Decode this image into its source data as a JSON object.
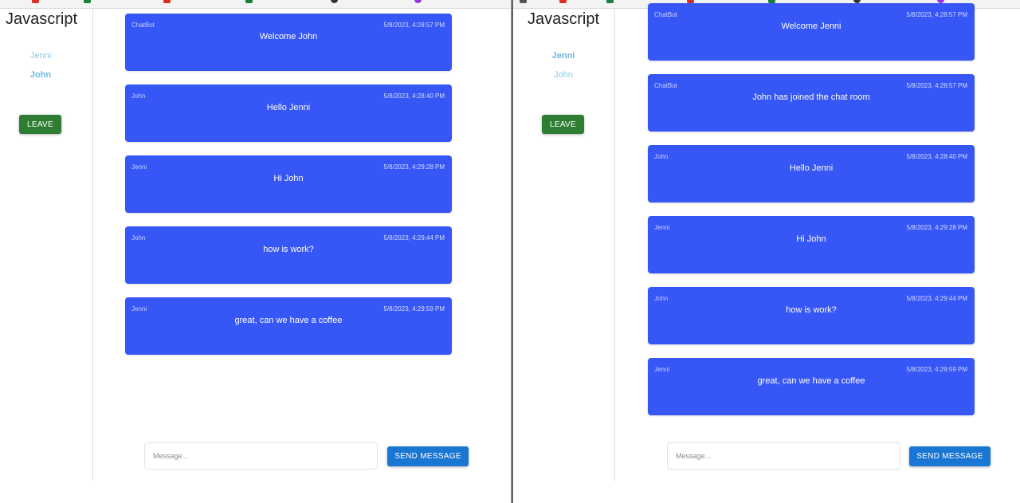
{
  "colors": {
    "message_card": "#3656f5",
    "leave_button": "#2e7d32",
    "send_button": "#1976d2",
    "user_link": "#8ecbe8"
  },
  "windows": [
    {
      "app_title": "Javascript",
      "users": [
        {
          "name": "Jenni",
          "active": false
        },
        {
          "name": "John",
          "active": true
        }
      ],
      "leave_label": "LEAVE",
      "messages": [
        {
          "sender": "ChatBot",
          "time": "5/8/2023, 4:28:57 PM",
          "text": "Welcome John"
        },
        {
          "sender": "John",
          "time": "5/8/2023, 4:28:40 PM",
          "text": "Hello Jenni"
        },
        {
          "sender": "Jenni",
          "time": "5/8/2023, 4:29:28 PM",
          "text": "Hi John"
        },
        {
          "sender": "John",
          "time": "5/8/2023, 4:29:44 PM",
          "text": "how is work?"
        },
        {
          "sender": "Jenni",
          "time": "5/8/2023, 4:29:59 PM",
          "text": "great, can we have a coffee"
        }
      ],
      "input_placeholder": "Message...",
      "send_label": "SEND MESSAGE"
    },
    {
      "app_title": "Javascript",
      "users": [
        {
          "name": "Jenni",
          "active": true
        },
        {
          "name": "John",
          "active": false
        }
      ],
      "leave_label": "LEAVE",
      "messages": [
        {
          "sender": "ChatBot",
          "time": "5/8/2023, 4:28:57 PM",
          "text": "Welcome Jenni"
        },
        {
          "sender": "ChatBot",
          "time": "5/8/2023, 4:28:57 PM",
          "text": "John has joined the chat room"
        },
        {
          "sender": "John",
          "time": "5/8/2023, 4:28:40 PM",
          "text": "Hello Jenni"
        },
        {
          "sender": "Jenni",
          "time": "5/8/2023, 4:29:28 PM",
          "text": "Hi John"
        },
        {
          "sender": "John",
          "time": "5/8/2023, 4:29:44 PM",
          "text": "how is work?"
        },
        {
          "sender": "Jenni",
          "time": "5/8/2023, 4:29:59 PM",
          "text": "great, can we have a coffee"
        }
      ],
      "input_placeholder": "Message...",
      "send_label": "SEND MESSAGE"
    }
  ]
}
